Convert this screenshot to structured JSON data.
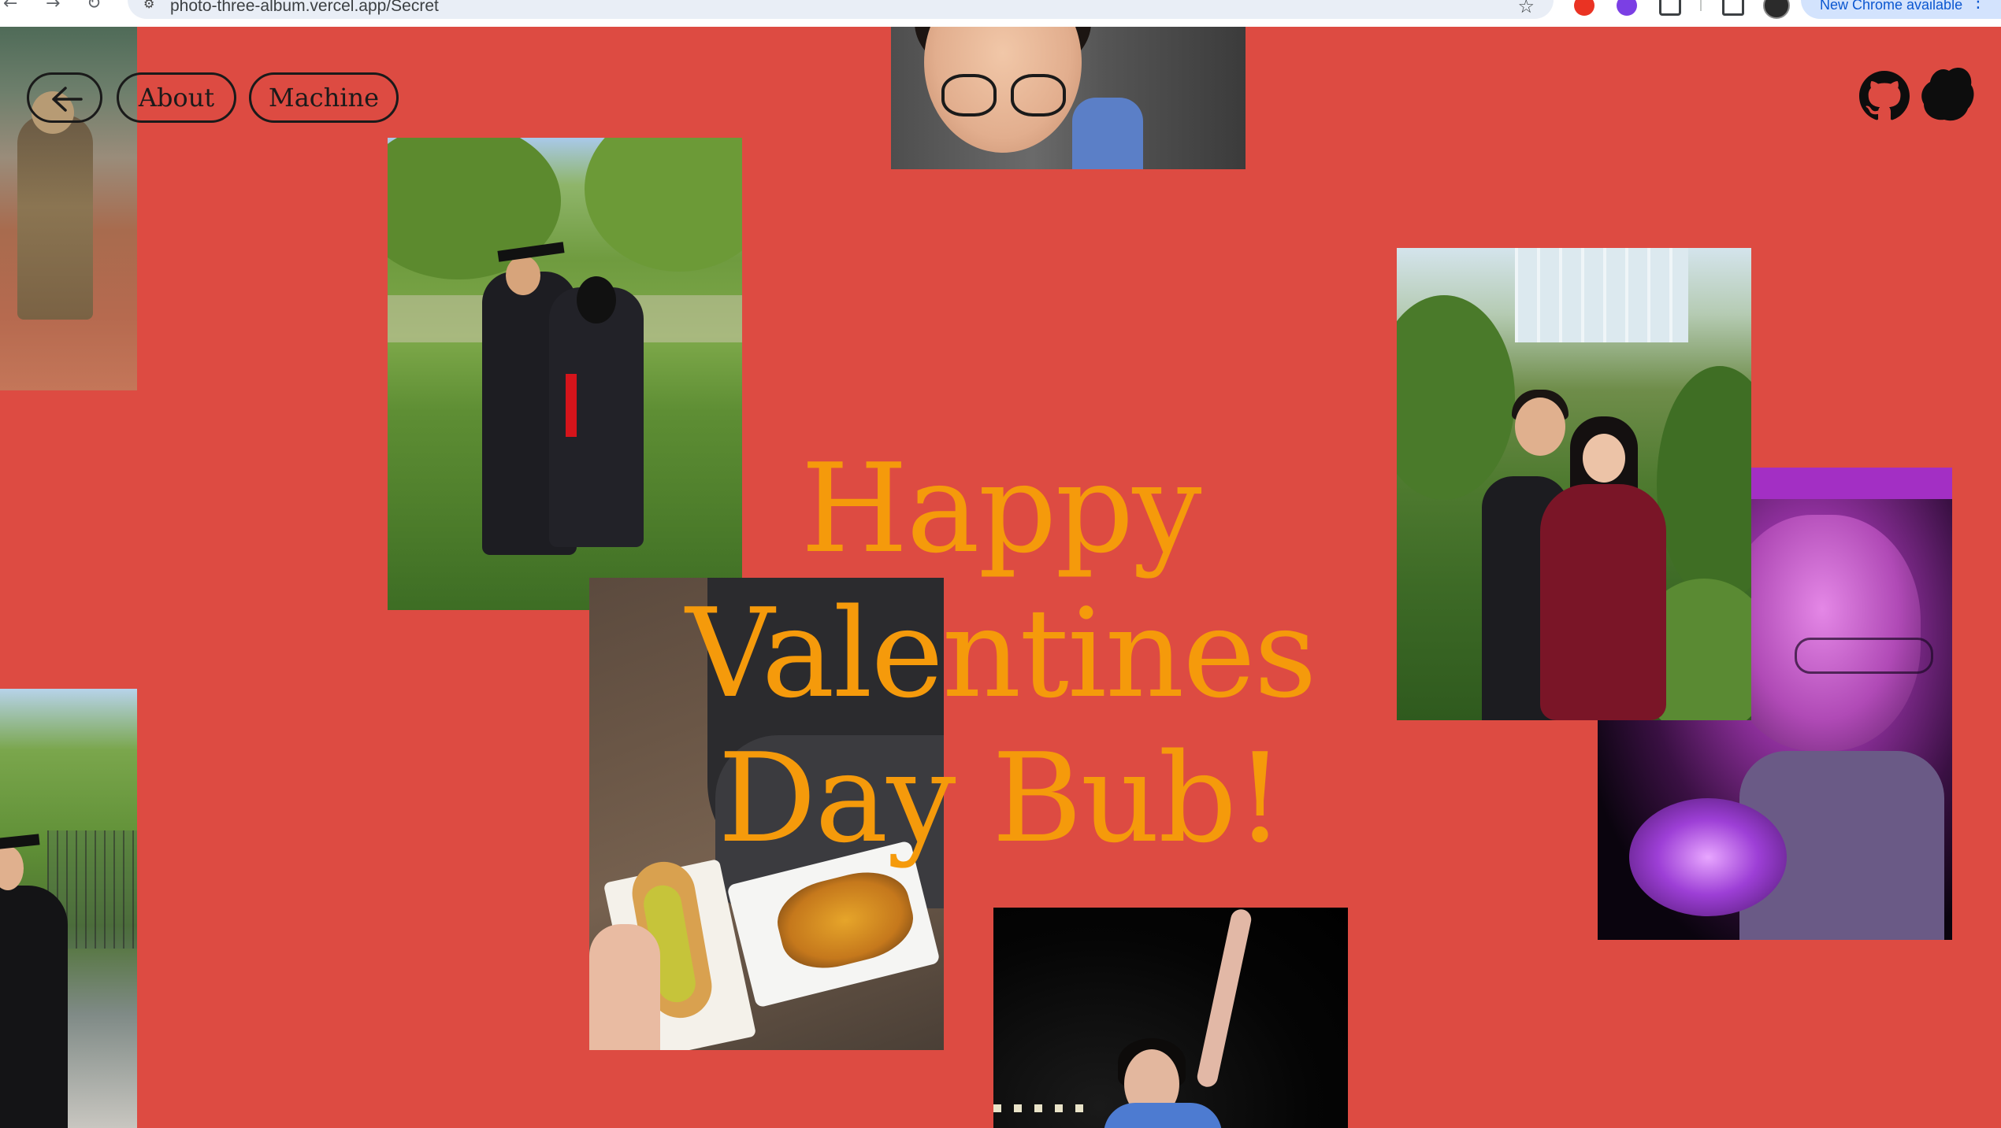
{
  "browser": {
    "url": "photo-three-album.vercel.app/Secret",
    "update_label": "New Chrome available",
    "update_menu": "⋮",
    "nav_back": "←",
    "nav_forward": "→",
    "nav_reload": "↻",
    "bookmark_icon": "star-icon"
  },
  "nav": {
    "back_icon": "arrow-left-icon",
    "about_label": "About",
    "machine_label": "Machine"
  },
  "top_right": {
    "github_icon": "github-icon",
    "blob_icon": "blob-logo-icon"
  },
  "title": {
    "line1": "Happy Valentines",
    "line2": "Day Bub!"
  },
  "colors": {
    "background": "#dd4b42",
    "title": "#f59a0b",
    "pill_border": "#1a1a1a"
  }
}
